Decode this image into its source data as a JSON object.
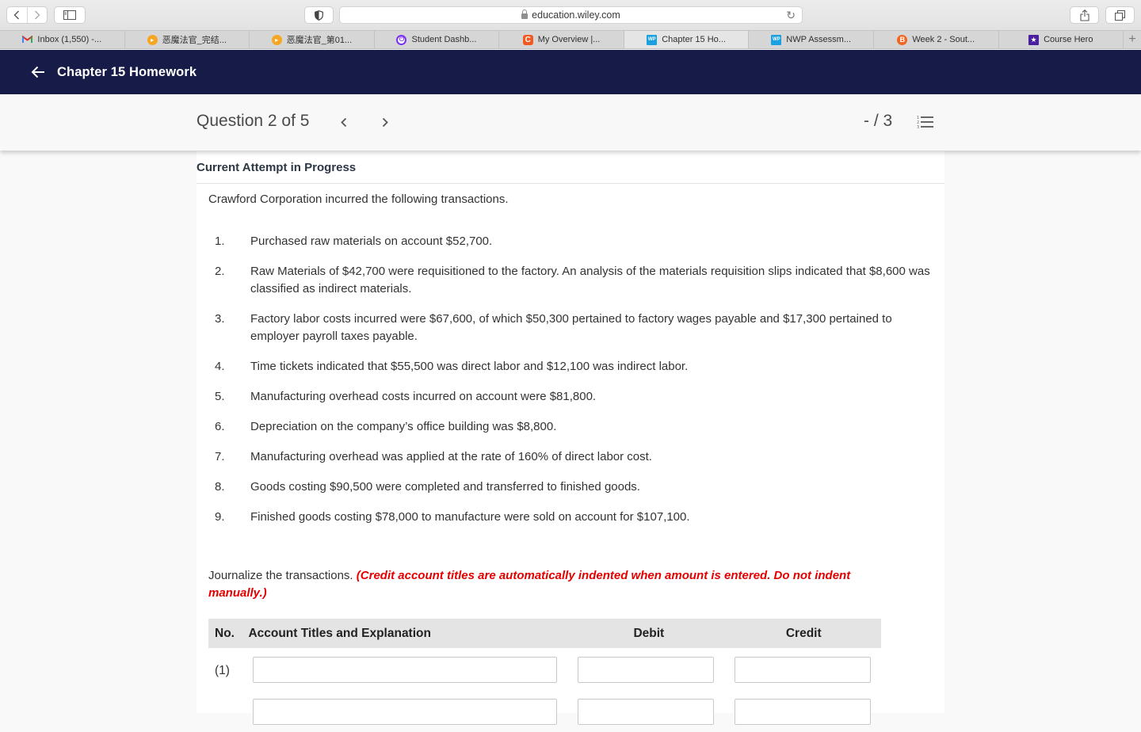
{
  "browser": {
    "url": "education.wiley.com",
    "tabs": [
      {
        "label": "Inbox (1,550) -...",
        "icon": "gmail-icon",
        "color": "#d93025"
      },
      {
        "label": "恶魔法官_完结...",
        "icon": "play-circle-icon",
        "color": "#f5a623"
      },
      {
        "label": "恶魔法官_第01...",
        "icon": "play-circle-icon",
        "color": "#f5a623"
      },
      {
        "label": "Student Dashb...",
        "icon": "power-icon",
        "color": "#7b2ff2"
      },
      {
        "label": "My Overview |...",
        "icon": "c-logo-icon",
        "color": "#f05a22"
      },
      {
        "label": "Chapter 15 Ho...",
        "icon": "wp-logo-icon",
        "color": "#1ba1e2"
      },
      {
        "label": "NWP Assessm...",
        "icon": "wp-logo-icon",
        "color": "#1ba1e2"
      },
      {
        "label": "Week 2 - Sout...",
        "icon": "b-logo-icon",
        "color": "#f26522"
      },
      {
        "label": "Course Hero",
        "icon": "star-badge-icon",
        "color": "#4a1fa0"
      }
    ],
    "active_tab_index": 5,
    "new_tab_label": "+"
  },
  "app": {
    "title": "Chapter 15 Homework",
    "header_color": "#161b48"
  },
  "question_bar": {
    "title": "Question 2 of 5",
    "score": "- / 3"
  },
  "content": {
    "attempt_label": "Current Attempt in Progress",
    "intro": "Crawford Corporation incurred the following transactions.",
    "transactions": [
      {
        "num": "1.",
        "text": "Purchased raw materials on account $52,700."
      },
      {
        "num": "2.",
        "text": "Raw Materials of $42,700 were requisitioned to the factory. An analysis of the materials requisition slips indicated that $8,600 was classified as indirect materials."
      },
      {
        "num": "3.",
        "text": "Factory labor costs incurred were $67,600, of which $50,300 pertained to factory wages payable and $17,300 pertained to employer payroll taxes payable."
      },
      {
        "num": "4.",
        "text": "Time tickets indicated that $55,500 was direct labor and $12,100 was indirect labor."
      },
      {
        "num": "5.",
        "text": "Manufacturing overhead costs incurred on account were $81,800."
      },
      {
        "num": "6.",
        "text": "Depreciation on the company’s office building was $8,800."
      },
      {
        "num": "7.",
        "text": "Manufacturing overhead was applied at the rate of 160% of direct labor cost."
      },
      {
        "num": "8.",
        "text": "Goods costing $90,500 were completed and transferred to finished goods."
      },
      {
        "num": "9.",
        "text": "Finished goods costing $78,000 to manufacture were sold on account for $107,100."
      }
    ],
    "instruction": "Journalize the transactions.",
    "warning": "(Credit account titles are automatically indented when amount is entered. Do not indent manually.)",
    "warning_color": "#e50000"
  },
  "journal": {
    "headers": {
      "no": "No.",
      "account": "Account Titles and Explanation",
      "debit": "Debit",
      "credit": "Credit"
    },
    "rows": [
      {
        "num": "(1)",
        "account": "",
        "debit": "",
        "credit": ""
      },
      {
        "num": "",
        "account": "",
        "debit": "",
        "credit": ""
      }
    ]
  }
}
